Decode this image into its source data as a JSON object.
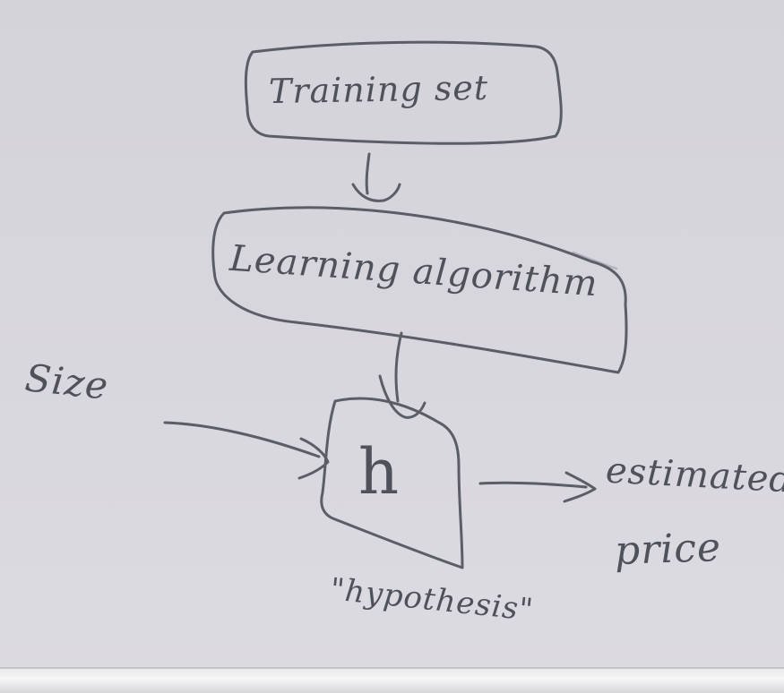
{
  "diagram": {
    "training_set": "Training set",
    "learning_algorithm": "Learning algorithm",
    "hypothesis_symbol": "h",
    "input_label": "Size",
    "hypothesis_caption": "\"hypothesis\"",
    "output_label_line1": "estimated",
    "output_label_line2": "price"
  },
  "colors": {
    "board": "#d6d5db",
    "ink": "#5b5e66",
    "bottom_bar": "#f0f0f2"
  }
}
